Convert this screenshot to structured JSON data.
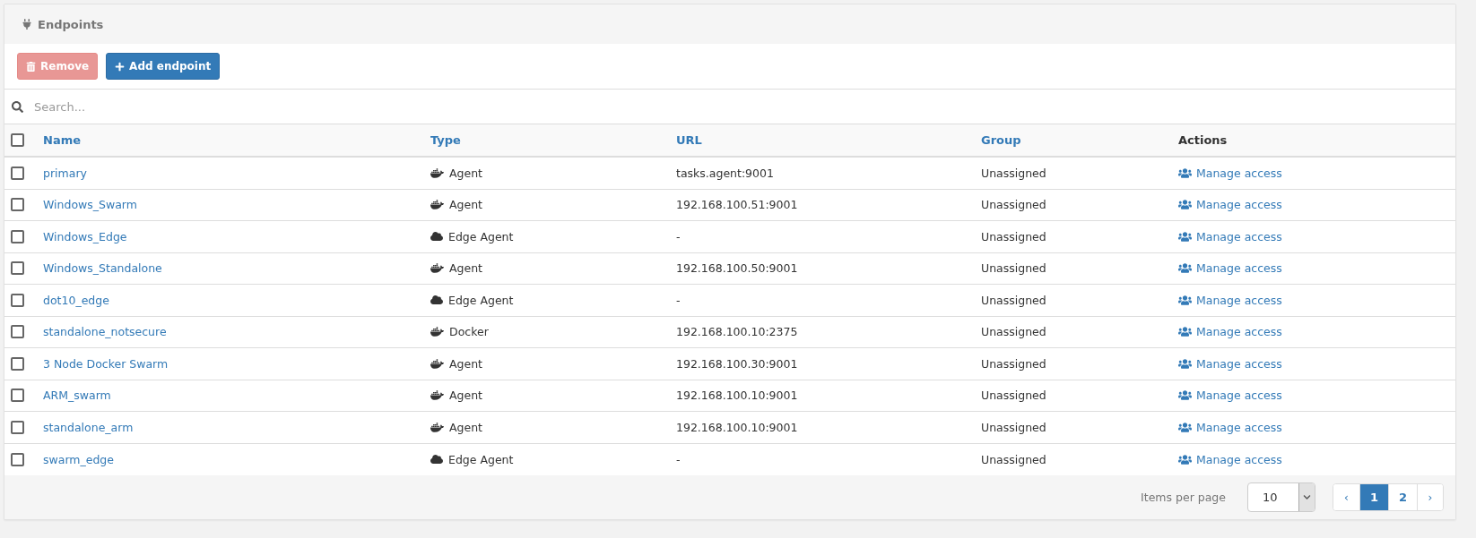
{
  "panel": {
    "title": "Endpoints"
  },
  "toolbar": {
    "buttons": [
      {
        "label": "Remove",
        "kind": "remove",
        "disabled": true
      },
      {
        "label": "Add endpoint",
        "kind": "add",
        "disabled": false
      }
    ]
  },
  "search": {
    "placeholder": "Search..."
  },
  "table": {
    "select_all": {
      "checked": false
    },
    "columns": [
      {
        "label": "Name",
        "sortable": true
      },
      {
        "label": "Type",
        "sortable": true
      },
      {
        "label": "URL",
        "sortable": true
      },
      {
        "label": "Group",
        "sortable": true
      },
      {
        "label": "Actions",
        "sortable": false
      }
    ],
    "rows": [
      {
        "checked": false,
        "name": "primary",
        "type": {
          "label": "Agent",
          "kind": "agent"
        },
        "url": "tasks.agent:9001",
        "group": "Unassigned",
        "action": "Manage access"
      },
      {
        "checked": false,
        "name": "Windows_Swarm",
        "type": {
          "label": "Agent",
          "kind": "agent"
        },
        "url": "192.168.100.51:9001",
        "group": "Unassigned",
        "action": "Manage access"
      },
      {
        "checked": false,
        "name": "Windows_Edge",
        "type": {
          "label": "Edge Agent",
          "kind": "edge"
        },
        "url": "-",
        "group": "Unassigned",
        "action": "Manage access"
      },
      {
        "checked": false,
        "name": "Windows_Standalone",
        "type": {
          "label": "Agent",
          "kind": "agent"
        },
        "url": "192.168.100.50:9001",
        "group": "Unassigned",
        "action": "Manage access"
      },
      {
        "checked": false,
        "name": "dot10_edge",
        "type": {
          "label": "Edge Agent",
          "kind": "edge"
        },
        "url": "-",
        "group": "Unassigned",
        "action": "Manage access"
      },
      {
        "checked": false,
        "name": "standalone_notsecure",
        "type": {
          "label": "Docker",
          "kind": "docker"
        },
        "url": "192.168.100.10:2375",
        "group": "Unassigned",
        "action": "Manage access"
      },
      {
        "checked": false,
        "name": "3 Node Docker Swarm",
        "type": {
          "label": "Agent",
          "kind": "agent"
        },
        "url": "192.168.100.30:9001",
        "group": "Unassigned",
        "action": "Manage access"
      },
      {
        "checked": false,
        "name": "ARM_swarm",
        "type": {
          "label": "Agent",
          "kind": "agent"
        },
        "url": "192.168.100.10:9001",
        "group": "Unassigned",
        "action": "Manage access"
      },
      {
        "checked": false,
        "name": "standalone_arm",
        "type": {
          "label": "Agent",
          "kind": "agent"
        },
        "url": "192.168.100.10:9001",
        "group": "Unassigned",
        "action": "Manage access"
      },
      {
        "checked": false,
        "name": "swarm_edge",
        "type": {
          "label": "Edge Agent",
          "kind": "edge"
        },
        "url": "-",
        "group": "Unassigned",
        "action": "Manage access"
      }
    ]
  },
  "footer": {
    "items_per_page_label": "Items per page",
    "items_per_page": "10",
    "prev": "‹",
    "pages": [
      {
        "label": "1",
        "selected": true
      },
      {
        "label": "2",
        "selected": false
      }
    ],
    "next": "›"
  }
}
